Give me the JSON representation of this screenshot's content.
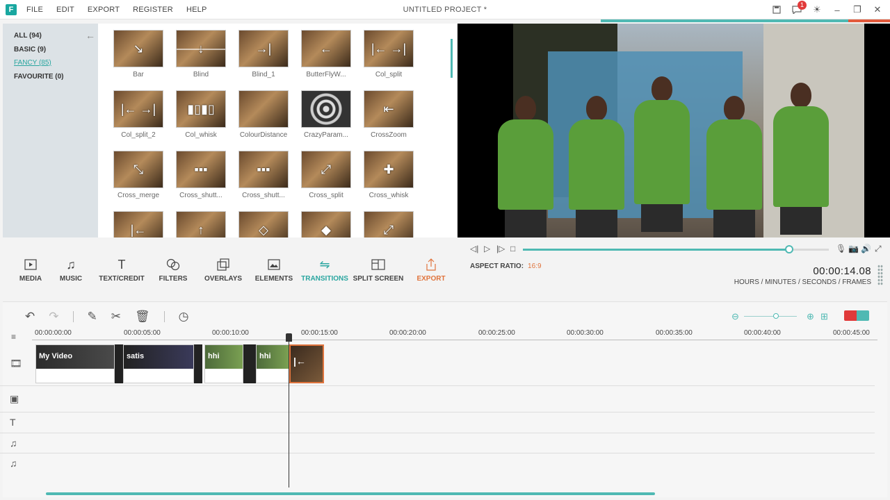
{
  "app": {
    "logo_letter": "F",
    "project_title": "UNTITLED PROJECT *",
    "notification_count": "1"
  },
  "menu": [
    "FILE",
    "EDIT",
    "EXPORT",
    "REGISTER",
    "HELP"
  ],
  "categories": [
    {
      "label": "ALL (94)"
    },
    {
      "label": "BASIC (9)"
    },
    {
      "label": "FANCY (85)",
      "active": true
    },
    {
      "label": "FAVOURITE (0)"
    }
  ],
  "transitions": [
    {
      "label": "Bar",
      "icon": "arrow-diagonal-icon"
    },
    {
      "label": "Blind",
      "icon": "arrow-down-icon"
    },
    {
      "label": "Blind_1",
      "icon": "arrows-in-icon"
    },
    {
      "label": "ButterFlyW...",
      "icon": "arrow-left-icon"
    },
    {
      "label": "Col_split",
      "icon": "split-icon"
    },
    {
      "label": "Col_split_2",
      "icon": "split-icon"
    },
    {
      "label": "Col_whisk",
      "icon": "columns-icon"
    },
    {
      "label": "ColourDistance",
      "icon": "blur-icon"
    },
    {
      "label": "CrazyParam...",
      "icon": "ripple-icon"
    },
    {
      "label": "CrossZoom",
      "icon": "zoom-icon"
    },
    {
      "label": "Cross_merge",
      "icon": "merge-icon"
    },
    {
      "label": "Cross_shutt...",
      "icon": "grid-icon"
    },
    {
      "label": "Cross_shutt...",
      "icon": "grid-icon"
    },
    {
      "label": "Cross_split",
      "icon": "expand-icon"
    },
    {
      "label": "Cross_whisk",
      "icon": "cross-icon"
    }
  ],
  "player": {
    "aspect_ratio_label": "ASPECT RATIO:",
    "aspect_ratio_value": "16:9",
    "timecode": "00:00:14.08",
    "time_format": "HOURS / MINUTES / SECONDS / FRAMES",
    "progress": 0.87
  },
  "toolbar": [
    {
      "label": "MEDIA",
      "icon": "media-icon"
    },
    {
      "label": "MUSIC",
      "icon": "music-icon"
    },
    {
      "label": "TEXT/CREDIT",
      "icon": "text-icon"
    },
    {
      "label": "FILTERS",
      "icon": "filters-icon"
    },
    {
      "label": "OVERLAYS",
      "icon": "overlays-icon"
    },
    {
      "label": "ELEMENTS",
      "icon": "elements-icon"
    },
    {
      "label": "TRANSITIONS",
      "icon": "transitions-icon",
      "active": true
    },
    {
      "label": "SPLIT SCREEN",
      "icon": "split-screen-icon"
    },
    {
      "label": "EXPORT",
      "icon": "export-icon"
    }
  ],
  "timeline": {
    "ruler_labels": [
      "00:00:00:00",
      "00:00:05:00",
      "00:00:10:00",
      "00:00:15:00",
      "00:00:20:00",
      "00:00:25:00",
      "00:00:30:00",
      "00:00:35:00",
      "00:00:40:00",
      "00:00:45:00"
    ],
    "clips": [
      {
        "label": "My Video"
      },
      {
        "label": "satis"
      },
      {
        "label": "hhi"
      },
      {
        "label": "hhi"
      },
      {
        "label": ""
      }
    ]
  },
  "colors": {
    "accent": "#4fb9b3",
    "export": "#e0743d",
    "badge": "#e23b3b"
  }
}
